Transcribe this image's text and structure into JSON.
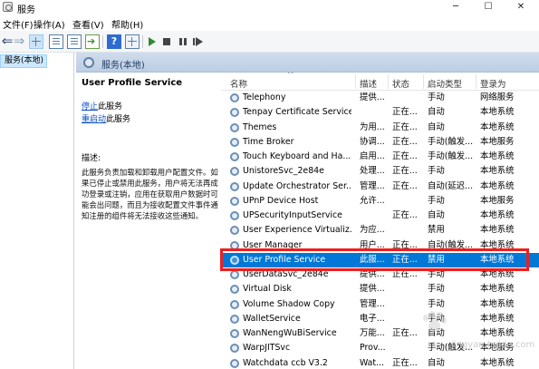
{
  "window": {
    "title": "服务"
  },
  "menu": [
    "文件(F)",
    "操作(A)",
    "查看(V)",
    "帮助(H)"
  ],
  "tree": {
    "selected": "服务(本地)"
  },
  "panel": {
    "title": "服务(本地)"
  },
  "detail": {
    "service_name": "User Profile Service",
    "stop_link": "停止",
    "stop_suffix": "此服务",
    "restart_link": "重启动",
    "restart_suffix": "此服务",
    "desc_label": "描述:",
    "desc_text": "此服务负责加载和卸载用户配置文件。如果已停止或禁用此服务，用户将无法再成功登录或注销，应用在获取用户数据时可能会出问题，而且为接收配置文件事件通知注册的组件将无法接收这些通知。"
  },
  "columns": {
    "name": "名称",
    "desc": "描述",
    "state": "状态",
    "startup": "启动类型",
    "login": "登录为"
  },
  "rows": [
    {
      "name": "Telephony",
      "desc": "提供...",
      "state": "",
      "startup": "手动",
      "login": "网络服务"
    },
    {
      "name": "Tenpay Certificate Service",
      "desc": "",
      "state": "正在...",
      "startup": "自动",
      "login": "本地系统"
    },
    {
      "name": "Themes",
      "desc": "为用...",
      "state": "正在...",
      "startup": "自动",
      "login": "本地系统"
    },
    {
      "name": "Time Broker",
      "desc": "协调...",
      "state": "正在...",
      "startup": "手动(触发...",
      "login": "本地服务"
    },
    {
      "name": "Touch Keyboard and Ha...",
      "desc": "启用...",
      "state": "正在...",
      "startup": "手动(触发...",
      "login": "本地系统"
    },
    {
      "name": "UnistoreSvc_2e84e",
      "desc": "处理...",
      "state": "正在...",
      "startup": "手动",
      "login": "本地系统"
    },
    {
      "name": "Update Orchestrator Ser...",
      "desc": "管理...",
      "state": "正在...",
      "startup": "自动(延迟...",
      "login": "本地系统"
    },
    {
      "name": "UPnP Device Host",
      "desc": "允许...",
      "state": "",
      "startup": "手动",
      "login": "本地服务"
    },
    {
      "name": "UPSecurityInputService",
      "desc": "",
      "state": "正在...",
      "startup": "自动",
      "login": "本地系统"
    },
    {
      "name": "User Experience Virtualiz...",
      "desc": "为应...",
      "state": "",
      "startup": "禁用",
      "login": "本地系统"
    },
    {
      "name": "User Manager",
      "desc": "用户...",
      "state": "正在...",
      "startup": "自动(触发...",
      "login": "本地系统"
    },
    {
      "name": "User Profile Service",
      "desc": "此服...",
      "state": "正在...",
      "startup": "禁用",
      "login": "本地系统"
    },
    {
      "name": "UserDataSvc_2e84e",
      "desc": "提供...",
      "state": "正在...",
      "startup": "手动",
      "login": "本地系统"
    },
    {
      "name": "Virtual Disk",
      "desc": "提供...",
      "state": "",
      "startup": "手动",
      "login": "本地系统"
    },
    {
      "name": "Volume Shadow Copy",
      "desc": "管理...",
      "state": "",
      "startup": "手动",
      "login": "本地系统"
    },
    {
      "name": "WalletService",
      "desc": "电子...",
      "state": "",
      "startup": "手动",
      "login": "本地系统"
    },
    {
      "name": "WanNengWuBiService",
      "desc": "万能...",
      "state": "正在...",
      "startup": "自动",
      "login": "本地系统"
    },
    {
      "name": "WarpJITSvc",
      "desc": "Prov...",
      "state": "",
      "startup": "手动(触发...",
      "login": "本地服务"
    },
    {
      "name": "Watchdata ccb V3.2",
      "desc": "Wat...",
      "state": "正在...",
      "startup": "自动",
      "login": "本地系统"
    }
  ],
  "selected_row": "User Profile Service",
  "watermark": {
    "text": "jingyan.baidu.com"
  },
  "colors": {
    "selection": "#0078d7",
    "highlight_border": "#f01e1e",
    "link": "#0a50c2"
  }
}
